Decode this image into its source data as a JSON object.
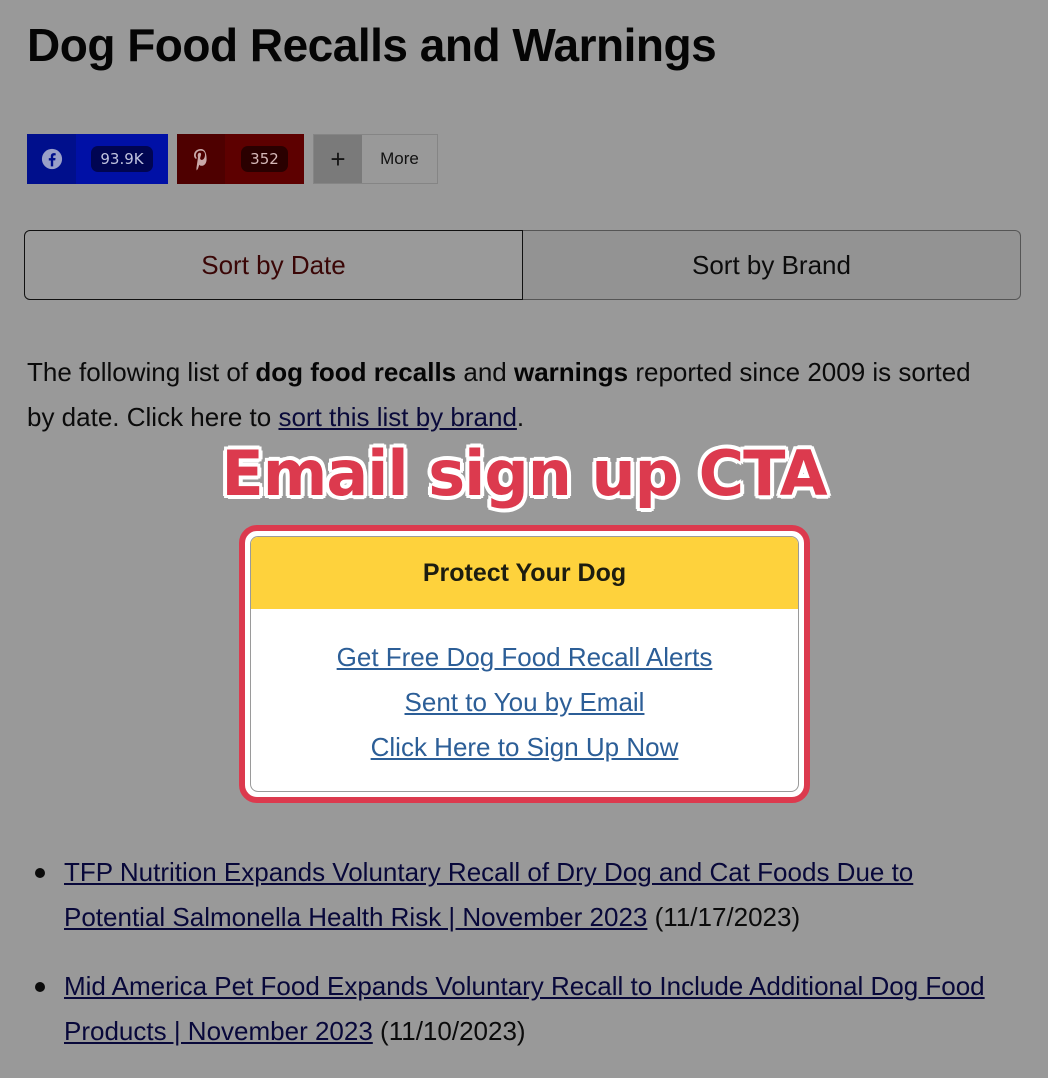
{
  "page": {
    "title": "Dog Food Recalls and Warnings"
  },
  "share": {
    "facebook": {
      "icon": "facebook-icon",
      "count": "93.9K",
      "color": "#0010a6"
    },
    "pinterest": {
      "icon": "pinterest-icon",
      "count": "352",
      "color": "#5d0000"
    },
    "more": {
      "icon": "plus-icon",
      "icon_glyph": "+",
      "label": "More"
    }
  },
  "sort": {
    "by_date": "Sort by Date",
    "by_brand": "Sort by Brand",
    "active": "by_date"
  },
  "intro": {
    "part1": "The following list of ",
    "bold1": "dog food recalls",
    "part2": " and ",
    "bold2": "warnings",
    "part3": " reported since 2009 is sorted by date.  Click here to ",
    "link": "sort this list by brand",
    "part4": "."
  },
  "annotation": {
    "label": "Email sign up CTA",
    "color": "#dc3a4e"
  },
  "cta": {
    "heading": "Protect Your Dog",
    "heading_bg": "#fed23c",
    "lines": [
      "Get Free Dog Food Recall Alerts",
      "Sent to You by Email",
      "Click Here to Sign Up Now"
    ],
    "link_color": "#2c5e97"
  },
  "recalls": [
    {
      "title": "TFP Nutrition Expands Voluntary Recall of Dry Dog and Cat Foods Due to Potential Salmonella Health Risk | November 2023",
      "date": "(11/17/2023)"
    },
    {
      "title": "Mid America Pet Food Expands Voluntary Recall to Include Additional Dog Food Products | November 2023",
      "date": "(11/10/2023)"
    }
  ]
}
